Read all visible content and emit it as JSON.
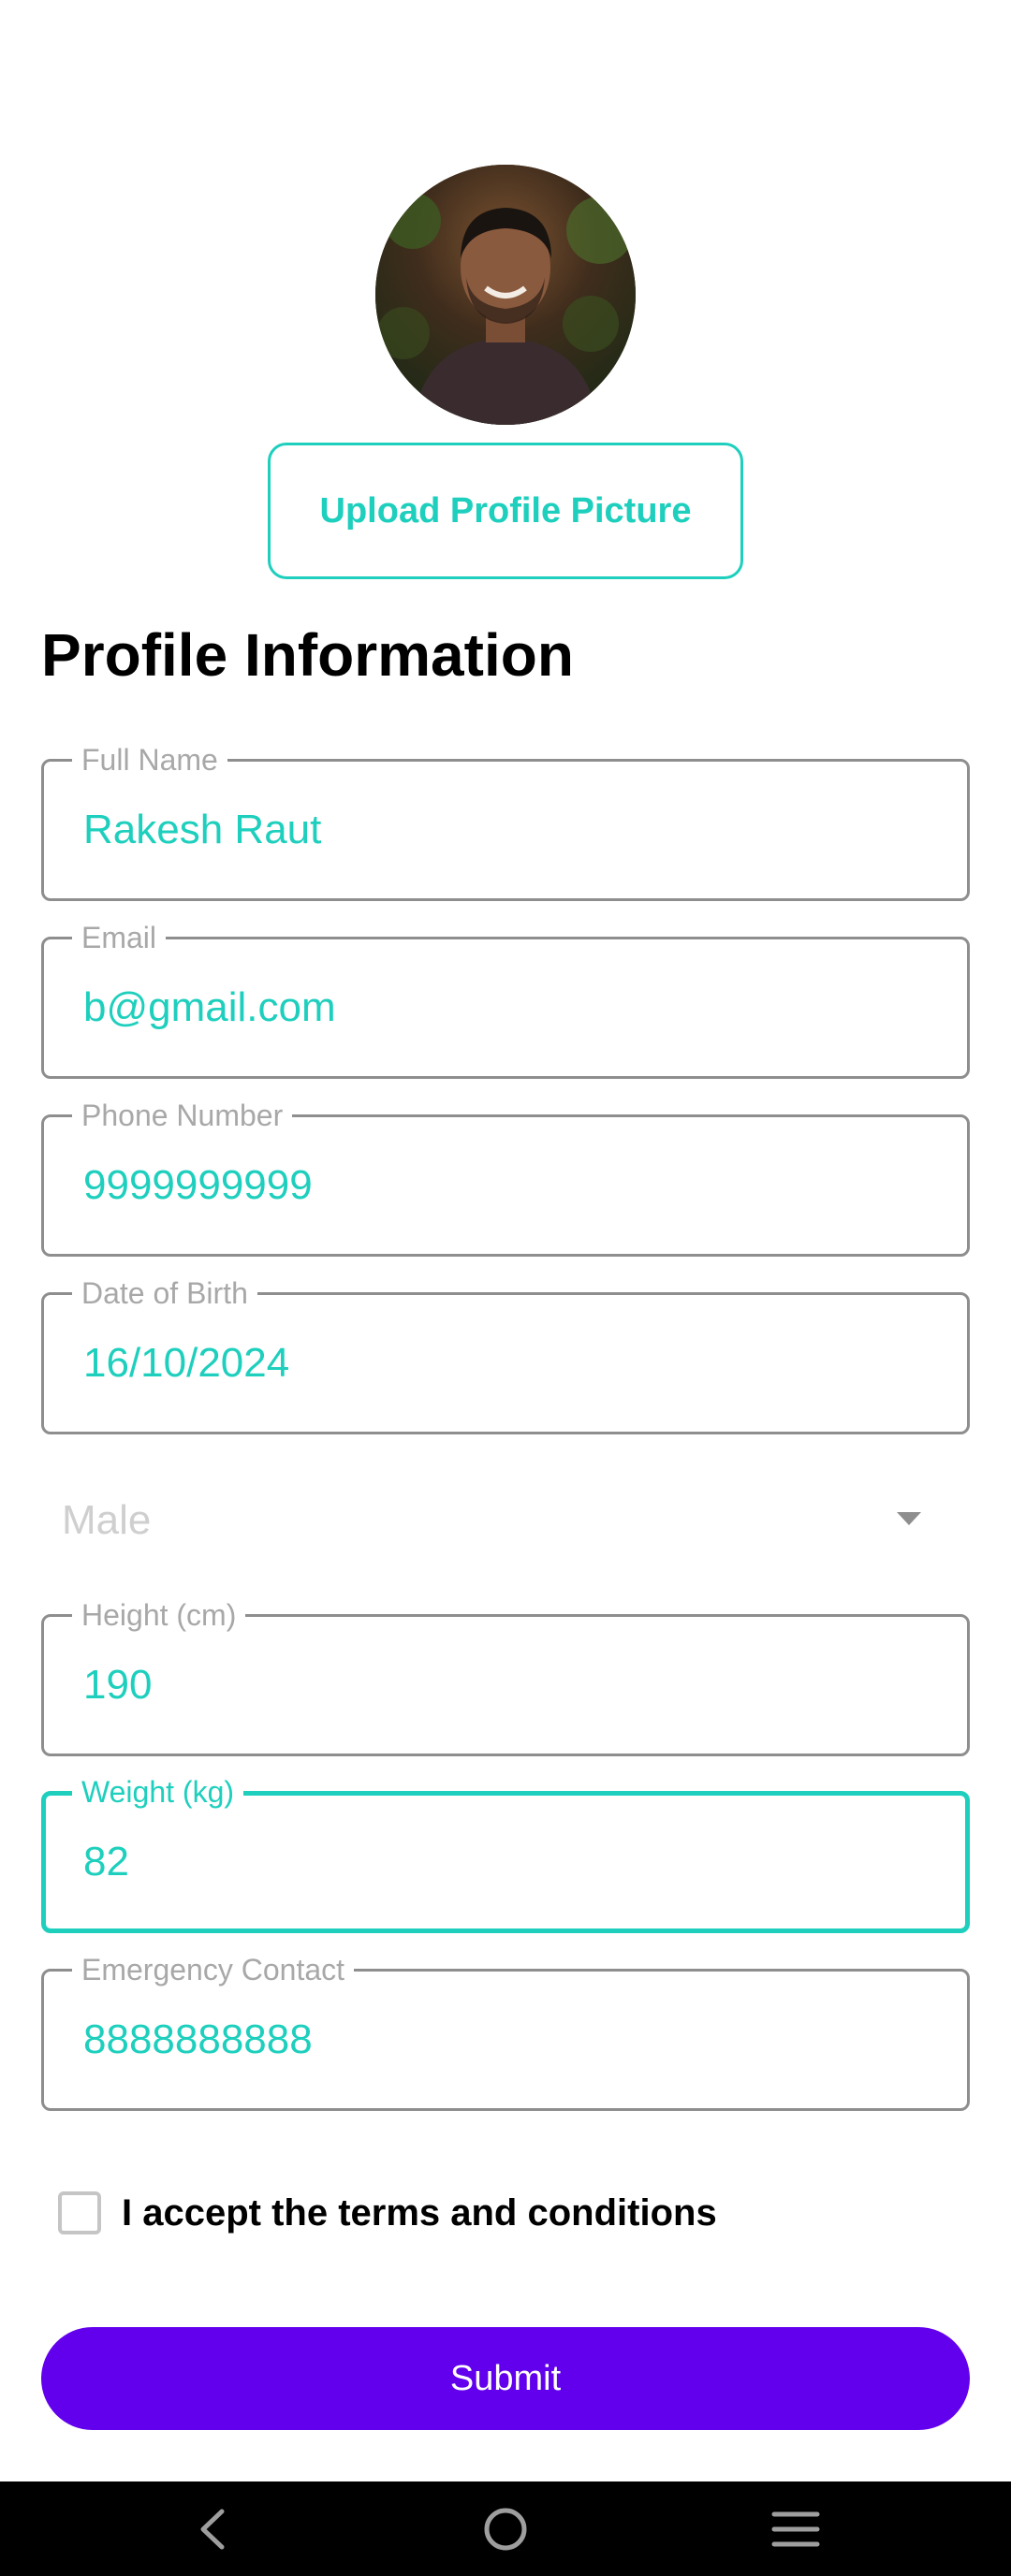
{
  "profile": {
    "avatar_icon": "profile-photo",
    "upload_label": "Upload Profile Picture"
  },
  "section_title": "Profile Information",
  "fields": {
    "full_name": {
      "label": "Full Name",
      "value": "Rakesh Raut"
    },
    "email": {
      "label": "Email",
      "value": "b@gmail.com"
    },
    "phone": {
      "label": "Phone Number",
      "value": "9999999999"
    },
    "dob": {
      "label": "Date of Birth",
      "value": "16/10/2024"
    },
    "height": {
      "label": "Height (cm)",
      "value": "190"
    },
    "weight": {
      "label": "Weight (kg)",
      "value": "82"
    },
    "emergency": {
      "label": "Emergency Contact",
      "value": "8888888888"
    }
  },
  "gender": {
    "selected": "Male",
    "icon": "dropdown-caret-icon"
  },
  "terms": {
    "label": "I accept the terms and conditions",
    "checked": false
  },
  "submit_label": "Submit",
  "colors": {
    "accent": "#1ecfbd",
    "primary": "#6200ee",
    "border": "#8e8e8e",
    "navbar": "#000000"
  },
  "navbar": {
    "back_icon": "back-icon",
    "home_icon": "home-icon",
    "recents_icon": "recents-icon"
  }
}
